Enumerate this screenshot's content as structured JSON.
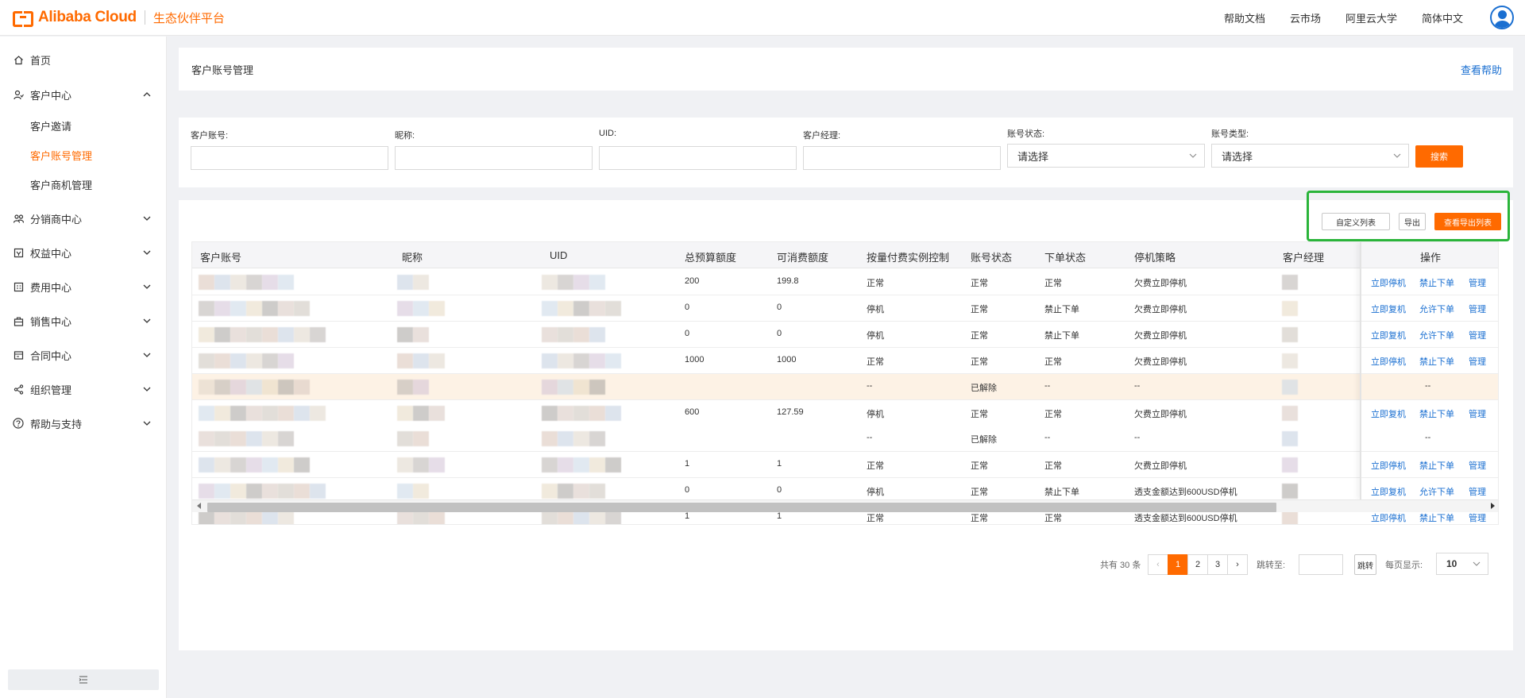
{
  "header": {
    "brand": "Alibaba Cloud",
    "brand_sub": "生态伙伴平台",
    "links": [
      "帮助文档",
      "云市场",
      "阿里云大学",
      "简体中文"
    ]
  },
  "sidebar": {
    "items": [
      {
        "label": "首页",
        "icon": "home-icon",
        "expanded": null
      },
      {
        "label": "客户中心",
        "icon": "customer-icon",
        "expanded": true
      },
      {
        "label": "分销商中心",
        "icon": "distributor-icon",
        "expanded": false
      },
      {
        "label": "权益中心",
        "icon": "rights-icon",
        "expanded": false
      },
      {
        "label": "费用中心",
        "icon": "billing-icon",
        "expanded": false
      },
      {
        "label": "销售中心",
        "icon": "sales-icon",
        "expanded": false
      },
      {
        "label": "合同中心",
        "icon": "contract-icon",
        "expanded": false
      },
      {
        "label": "组织管理",
        "icon": "org-icon",
        "expanded": false
      },
      {
        "label": "帮助与支持",
        "icon": "help-icon",
        "expanded": false
      }
    ],
    "sub_items": [
      "客户邀请",
      "客户账号管理",
      "客户商机管理"
    ],
    "active_sub": "客户账号管理"
  },
  "page": {
    "title": "客户账号管理",
    "help_link": "查看帮助"
  },
  "filters": {
    "account_label": "客户账号:",
    "nickname_label": "昵称:",
    "uid_label": "UID:",
    "manager_label": "客户经理:",
    "status_label": "账号状态:",
    "status_value": "请选择",
    "type_label": "账号类型:",
    "type_value": "请选择",
    "search_button": "搜索"
  },
  "toolbar": {
    "custom_columns": "自定义列表",
    "export": "导出",
    "view_exports": "查看导出列表"
  },
  "table": {
    "columns": [
      "客户账号",
      "昵称",
      "UID",
      "总预算额度",
      "可消费额度",
      "按量付费实例控制",
      "账号状态",
      "下单状态",
      "停机策略",
      "客户经理",
      "操作"
    ],
    "rows": [
      {
        "budget": "200",
        "available": "199.8",
        "control": "正常",
        "status": "正常",
        "order": "正常",
        "policy": "欠费立即停机",
        "ops": [
          "立即停机",
          "禁止下单",
          "管理"
        ]
      },
      {
        "budget": "0",
        "available": "0",
        "control": "停机",
        "status": "正常",
        "order": "禁止下单",
        "policy": "欠费立即停机",
        "ops": [
          "立即复机",
          "允许下单",
          "管理"
        ]
      },
      {
        "budget": "0",
        "available": "0",
        "control": "停机",
        "status": "正常",
        "order": "禁止下单",
        "policy": "欠费立即停机",
        "ops": [
          "立即复机",
          "允许下单",
          "管理"
        ]
      },
      {
        "budget": "1000",
        "available": "1000",
        "control": "正常",
        "status": "正常",
        "order": "正常",
        "policy": "欠费立即停机",
        "ops": [
          "立即停机",
          "禁止下单",
          "管理"
        ]
      },
      {
        "budget": "",
        "available": "",
        "control": "--",
        "status": "已解除",
        "order": "--",
        "policy": "--",
        "ops": [
          "--"
        ]
      },
      {
        "budget": "600",
        "available": "127.59",
        "control": "停机",
        "status": "正常",
        "order": "正常",
        "policy": "欠费立即停机",
        "ops": [
          "立即复机",
          "禁止下单",
          "管理"
        ]
      },
      {
        "budget": "",
        "available": "",
        "control": "--",
        "status": "已解除",
        "order": "--",
        "policy": "--",
        "ops": [
          "--"
        ]
      },
      {
        "budget": "1",
        "available": "1",
        "control": "正常",
        "status": "正常",
        "order": "正常",
        "policy": "欠费立即停机",
        "ops": [
          "立即停机",
          "禁止下单",
          "管理"
        ]
      },
      {
        "budget": "0",
        "available": "0",
        "control": "停机",
        "status": "正常",
        "order": "禁止下单",
        "policy": "透支金额达到600USD停机",
        "ops": [
          "立即复机",
          "允许下单",
          "管理"
        ]
      },
      {
        "budget": "1",
        "available": "1",
        "control": "正常",
        "status": "正常",
        "order": "正常",
        "policy": "透支金额达到600USD停机",
        "ops": [
          "立即停机",
          "禁止下单",
          "管理"
        ]
      }
    ],
    "highlighted_row": 4
  },
  "pagination": {
    "total": "共有 30 条",
    "prev": "‹",
    "pages": [
      "1",
      "2",
      "3"
    ],
    "current": "1",
    "next": "›",
    "jump_label": "跳转至:",
    "jump_button": "跳转",
    "per_page_label": "每页显示:",
    "per_page": "10"
  },
  "colors": {
    "accent": "#ff6a00",
    "link": "#1a6fd1",
    "highlight_border": "#2ab43a"
  }
}
